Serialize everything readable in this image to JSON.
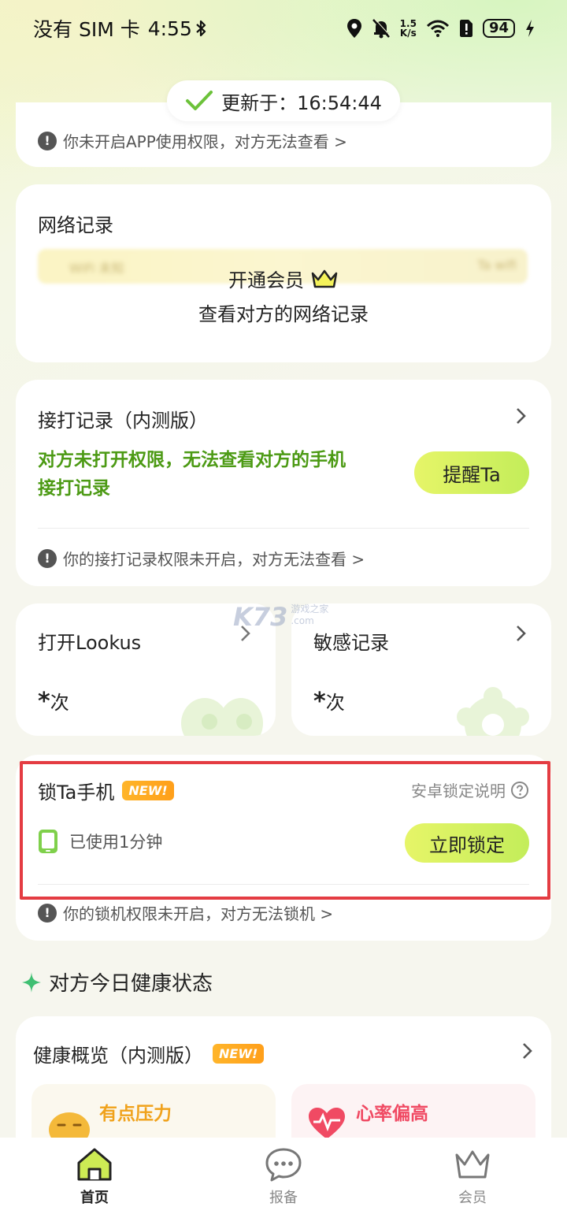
{
  "status_bar": {
    "carrier": "没有 SIM 卡",
    "time": "4:55",
    "speed_value": "1.5",
    "speed_unit": "K/s",
    "battery": "94"
  },
  "update": {
    "label": "更新于：16:54:44"
  },
  "app_permission_warning": "你未开启APP使用权限，对方无法查看 >",
  "network_card": {
    "title": "网络记录",
    "blur_left": "WiFi 未知",
    "blur_right": "Ta wifi",
    "overlay_line1": "开通会员",
    "overlay_line2": "查看对方的网络记录"
  },
  "call_card": {
    "title": "接打记录（内测版）",
    "message_line1": "对方未打开权限，无法查看对方的手机",
    "message_line2": "接打记录",
    "remind_button": "提醒Ta",
    "warning": "你的接打记录权限未开启，对方无法查看 >"
  },
  "watermark": {
    "main": "K73",
    "sub": "游戏之家",
    "url": ".com"
  },
  "open_lookus_card": {
    "title": "打开Lookus",
    "count_star": "*",
    "count_unit": "次"
  },
  "sensitive_card": {
    "title": "敏感记录",
    "count_star": "*",
    "count_unit": "次"
  },
  "lock_card": {
    "title": "锁Ta手机",
    "badge": "NEW!",
    "help_link": "安卓锁定说明",
    "usage": "已使用1分钟",
    "lock_button": "立即锁定",
    "warning": "你的锁机权限未开启，对方无法锁机 >"
  },
  "health_section": {
    "title": "对方今日健康状态"
  },
  "health_card": {
    "title": "健康概览（内测版）",
    "badge": "NEW!",
    "stress_label": "有点压力",
    "heart_label": "心率偏高"
  },
  "bottom_nav": {
    "home": "首页",
    "report": "报备",
    "member": "会员"
  },
  "colors": {
    "accent_green": "#4c9a14",
    "button_yellow_green": "#d6f160",
    "badge_orange": "#ffa81f",
    "highlight_red": "#e43c42",
    "stress_orange": "#f0a21c",
    "heart_pink": "#f04a63"
  }
}
